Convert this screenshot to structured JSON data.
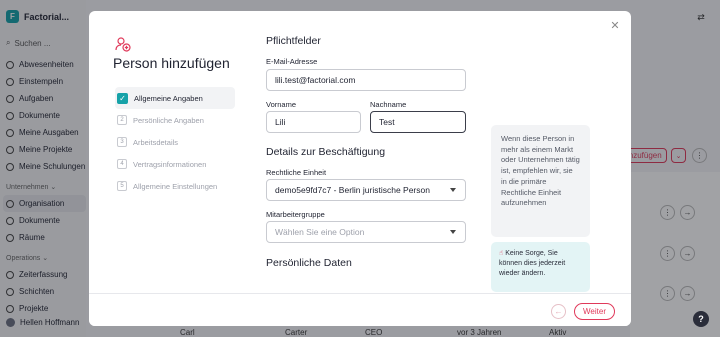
{
  "app": {
    "name": "Factorial..."
  },
  "sidebar": {
    "search_placeholder": "Suchen ...",
    "items": [
      {
        "label": "Abwesenheiten",
        "icon": "plane-icon"
      },
      {
        "label": "Einstempeln",
        "icon": "clock-icon"
      },
      {
        "label": "Aufgaben",
        "icon": "check-circle-icon"
      },
      {
        "label": "Dokumente",
        "icon": "document-icon"
      },
      {
        "label": "Meine Ausgaben",
        "icon": "receipt-icon"
      },
      {
        "label": "Meine Projekte",
        "icon": "folder-icon"
      },
      {
        "label": "Meine Schulungen",
        "icon": "graduation-icon"
      }
    ],
    "group_company": "Unternehmen",
    "company_items": [
      {
        "label": "Organisation",
        "icon": "people-icon",
        "active": true
      },
      {
        "label": "Dokumente",
        "icon": "document-icon"
      },
      {
        "label": "Räume",
        "icon": "building-icon"
      }
    ],
    "group_operations": "Operations",
    "operations_items": [
      {
        "label": "Zeiterfassung",
        "icon": "clock-icon"
      },
      {
        "label": "Schichten",
        "icon": "calendar-icon"
      },
      {
        "label": "Projekte",
        "icon": "folder-icon"
      }
    ],
    "user_name": "Hellen Hoffmann"
  },
  "background": {
    "action_label": "inzufügen",
    "bottom_row": {
      "first": "Carl",
      "last": "Carter",
      "role": "CEO",
      "since": "vor 3 Jahren",
      "status": "Aktiv"
    }
  },
  "modal": {
    "title": "Person hinzufügen",
    "steps": [
      {
        "number": "1",
        "label": "Allgemeine Angaben",
        "done": true
      },
      {
        "number": "2",
        "label": "Persönliche Angaben"
      },
      {
        "number": "3",
        "label": "Arbeitsdetails"
      },
      {
        "number": "4",
        "label": "Vertragsinformationen"
      },
      {
        "number": "5",
        "label": "Allgemeine Einstellungen"
      }
    ],
    "section_required": "Pflichtfelder",
    "email": {
      "label": "E-Mail-Adresse",
      "value": "lili.test@factorial.com"
    },
    "first_name": {
      "label": "Vorname",
      "value": "Lili"
    },
    "last_name": {
      "label": "Nachname",
      "value": "Test"
    },
    "section_employment": "Details zur Beschäftigung",
    "legal_entity": {
      "label": "Rechtliche Einheit",
      "value": "demo5e9fd7c7 - Berlin juristische Person"
    },
    "work_group": {
      "label": "Mitarbeitergruppe",
      "placeholder": "Wählen Sie eine Option"
    },
    "section_personal": "Persönliche Daten",
    "info_text": "Wenn diese Person in mehr als einem Markt oder Unternehmen tätig ist, empfehlen wir, sie in die primäre Rechtliche Einheit aufzunehmen",
    "tip_text": "Keine Sorge, Sie können dies jederzeit wieder ändern.",
    "next_label": "Weiter"
  },
  "colors": {
    "accent": "#e0395a",
    "teal": "#16a2a8"
  }
}
